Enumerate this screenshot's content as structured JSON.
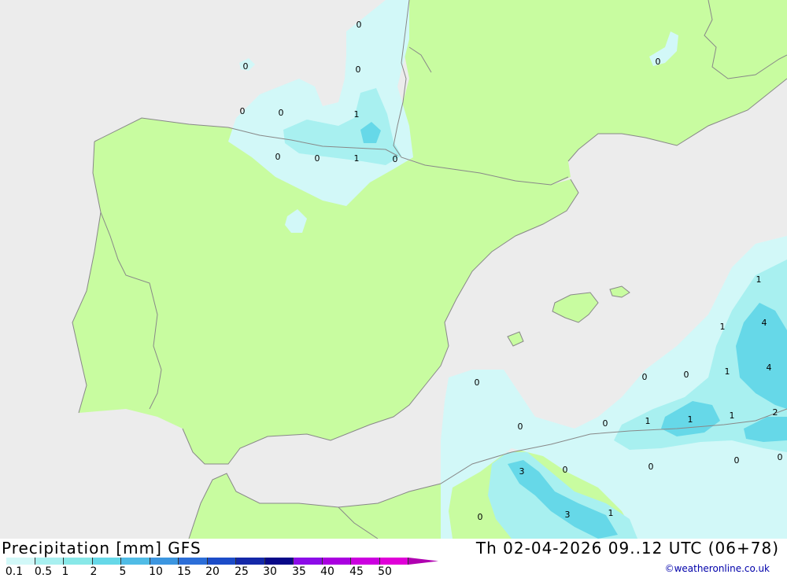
{
  "header": {
    "title_left": "Precipitation [mm] GFS",
    "title_right": "Th 02-04-2026 09..12 UTC (06+78)",
    "credit": "©weatheronline.co.uk"
  },
  "legend": {
    "labels": [
      "0.1",
      "0.5",
      "1",
      "2",
      "5",
      "10",
      "15",
      "20",
      "25",
      "30",
      "35",
      "40",
      "45",
      "50"
    ],
    "colors": [
      "#d2f8f8",
      "#a8f0f0",
      "#88e8e8",
      "#66d8e8",
      "#50bce6",
      "#3c96e0",
      "#2c6ed8",
      "#1c4cc8",
      "#1428a8",
      "#080888",
      "#8c0ce8",
      "#aa00e0",
      "#cc00e0",
      "#e000d8",
      "#b000b0"
    ]
  },
  "map_colors": {
    "sea": "#ececec",
    "land": "#c8fca0",
    "precip_light": "#d2f8f8",
    "precip_mid": "#a8f0f0",
    "precip_high": "#66d8e8",
    "border": "#888888"
  },
  "values": [
    {
      "text": "0"
    },
    {
      "text": "0"
    },
    {
      "text": "0"
    },
    {
      "text": "0"
    },
    {
      "text": "0"
    },
    {
      "text": "1"
    },
    {
      "text": "0"
    },
    {
      "text": "0"
    },
    {
      "text": "1"
    },
    {
      "text": "0"
    },
    {
      "text": "0"
    },
    {
      "text": "1"
    },
    {
      "text": "1"
    },
    {
      "text": "4"
    },
    {
      "text": "1"
    },
    {
      "text": "4"
    },
    {
      "text": "0"
    },
    {
      "text": "0"
    },
    {
      "text": "0"
    },
    {
      "text": "0"
    },
    {
      "text": "1"
    },
    {
      "text": "1"
    },
    {
      "text": "1"
    },
    {
      "text": "2"
    },
    {
      "text": "3"
    },
    {
      "text": "0"
    },
    {
      "text": "0"
    },
    {
      "text": "0"
    },
    {
      "text": "0"
    },
    {
      "text": "0"
    },
    {
      "text": "0"
    },
    {
      "text": "3"
    },
    {
      "text": "1"
    }
  ]
}
